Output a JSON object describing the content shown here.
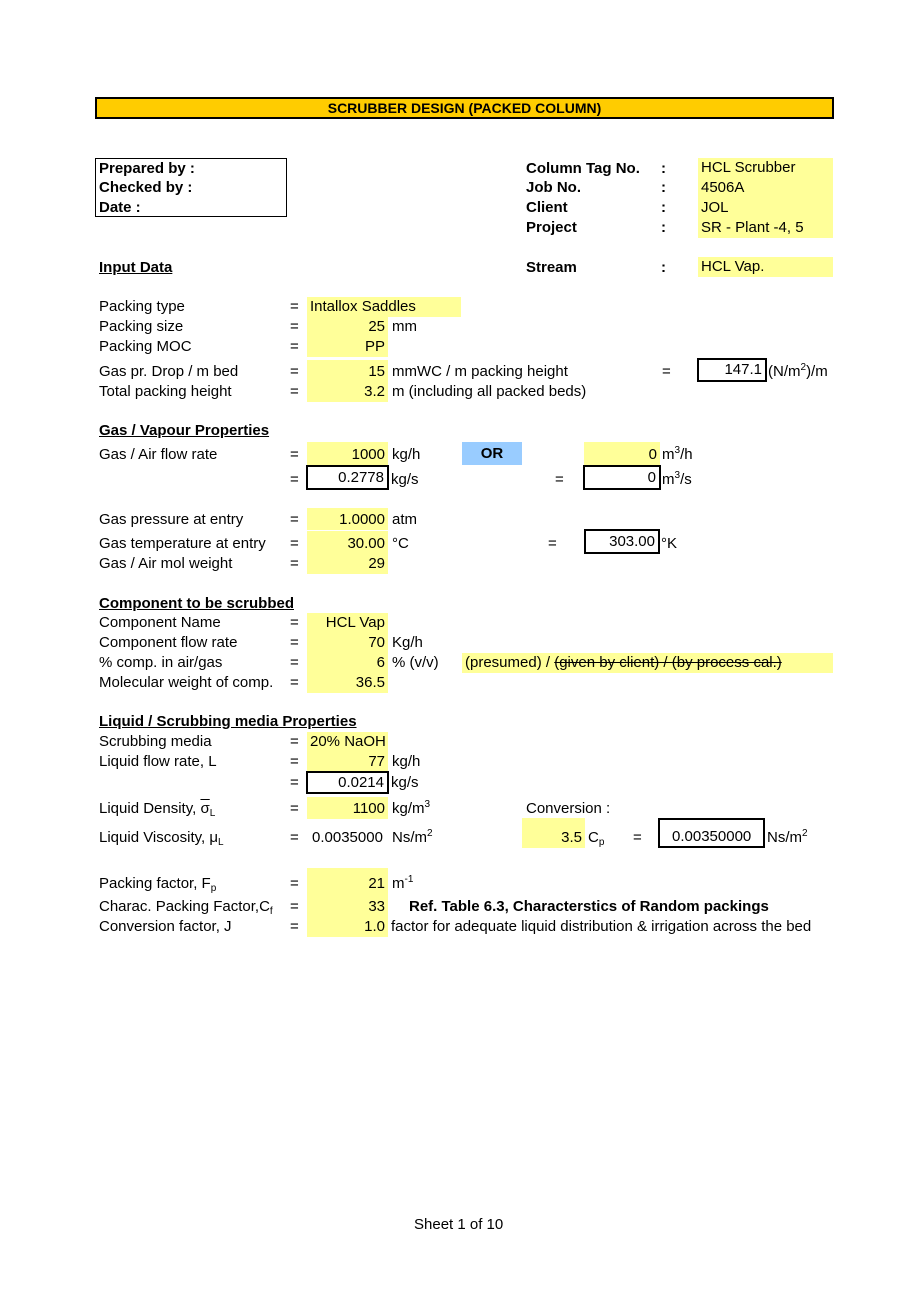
{
  "title": "SCRUBBER DESIGN (PACKED COLUMN)",
  "signoff": {
    "prepared_by": "Prepared by :",
    "checked_by": "Checked by :",
    "date": "Date :"
  },
  "header_info": [
    {
      "label": "Column Tag No.",
      "sep": ":",
      "value": "HCL Scrubber"
    },
    {
      "label": "Job No.",
      "sep": ":",
      "value": "4506A"
    },
    {
      "label": "Client",
      "sep": ":",
      "value": "JOL"
    },
    {
      "label": "Project",
      "sep": ":",
      "value": "SR - Plant -4, 5"
    },
    {
      "label": "Stream",
      "sep": ":",
      "value": "HCL Vap."
    }
  ],
  "input_data": {
    "heading": "Input Data",
    "eq": "=",
    "packing_type": {
      "label": "Packing type",
      "value": "Intallox Saddles"
    },
    "packing_size": {
      "label": "Packing size",
      "value": "25",
      "unit": "mm"
    },
    "packing_moc": {
      "label": "Packing MOC",
      "value": "PP"
    },
    "gas_pr_drop": {
      "label": "Gas pr. Drop / m bed",
      "value": "15",
      "unit": "mmWC / m packing height",
      "converted": "147.1",
      "converted_unit_pre": "(N/m",
      "converted_unit_sup": "2",
      "converted_unit_post": ")/m"
    },
    "total_height": {
      "label": "Total packing height",
      "value": "3.2",
      "unit": "m (including all packed beds)"
    }
  },
  "gas_props": {
    "heading": "Gas / Vapour Properties",
    "flow_rate": {
      "label": "Gas / Air flow rate",
      "value": "1000",
      "unit": "kg/h",
      "value_kgs": "0.2778",
      "unit_kgs": "kg/s",
      "or_label": "OR",
      "vol_value": "0",
      "vol_unit_pre": "m",
      "vol_unit_sup": "3",
      "vol_unit_post": "/h",
      "vol_value_s": "0",
      "vol_unit_s_post": "/s"
    },
    "pressure": {
      "label": "Gas pressure at entry",
      "value": "1.0000",
      "unit": "atm"
    },
    "temperature": {
      "label": "Gas temperature at entry",
      "value": "30.00",
      "unit": "°C",
      "kelvin": "303.00",
      "kelvin_unit": "°K"
    },
    "mol_weight": {
      "label": "Gas / Air mol weight",
      "value": "29"
    }
  },
  "component": {
    "heading": "Component to be scrubbed",
    "name": {
      "label": "Component Name",
      "value": "HCL Vap"
    },
    "flow": {
      "label": "Component flow rate",
      "value": "70",
      "unit": "Kg/h"
    },
    "percent": {
      "label": "% comp. in air/gas",
      "value": "6",
      "unit": "% (v/v)",
      "note_active": "(presumed) / ",
      "note_struck": "(given by client) / (by process cal.)"
    },
    "mw": {
      "label": "Molecular weight of comp.",
      "value": "36.5"
    }
  },
  "liquid": {
    "heading": "Liquid / Scrubbing media Properties",
    "media": {
      "label": "Scrubbing media",
      "value": "20% NaOH"
    },
    "flow": {
      "label": "Liquid flow rate, L",
      "value": "77",
      "unit": "kg/h",
      "value_kgs": "0.0214",
      "unit_kgs": "kg/s"
    },
    "density": {
      "label": "Liquid Density,",
      "symbol": "σ",
      "symbol_sub": "L",
      "value": "1100",
      "unit_pre": "kg/m",
      "unit_sup": "3"
    },
    "viscosity": {
      "label": "Liquid Viscosity, μ",
      "label_sub": "L",
      "value": "0.0035000",
      "unit_pre": "Ns/m",
      "unit_sup": "2"
    },
    "conversion": {
      "label": "Conversion :",
      "cp_value": "3.5",
      "cp_unit": "C",
      "cp_sub": "p",
      "eq": "=",
      "result": "0.00350000",
      "result_unit_pre": "Ns/m",
      "result_unit_sup": "2"
    }
  },
  "factors": {
    "packing_factor": {
      "label": "Packing factor, F",
      "label_sub": "p",
      "value": "21",
      "unit_pre": "m",
      "unit_sup": "-1"
    },
    "charac_factor": {
      "label": "Charac. Packing Factor,C",
      "label_sub": "f",
      "value": "33",
      "note": "Ref. Table 6.3, Characterstics of Random packings"
    },
    "conversion_j": {
      "label": "Conversion factor, J",
      "value": "1.0",
      "note": "factor for adequate liquid distribution & irrigation across the bed"
    }
  },
  "footer": "Sheet 1 of 10"
}
